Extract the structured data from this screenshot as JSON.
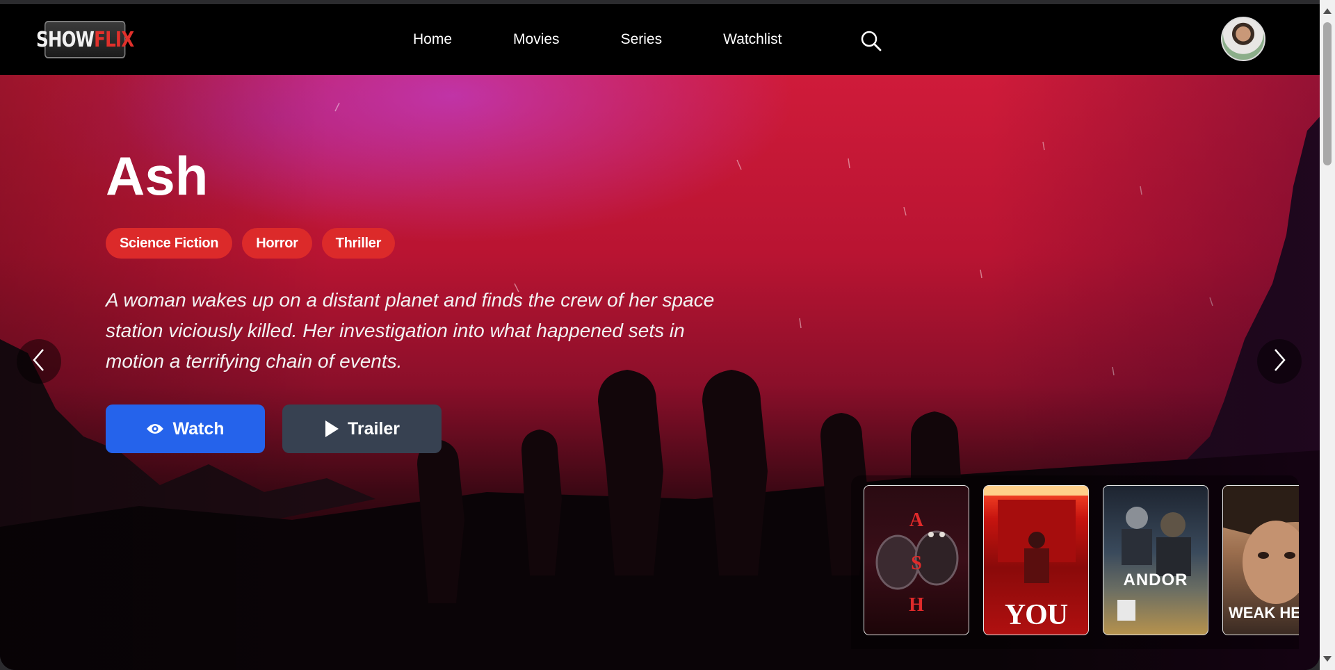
{
  "logo": {
    "show": "SHOW",
    "flix": "FLIX"
  },
  "nav": {
    "links": [
      "Home",
      "Movies",
      "Series",
      "Watchlist"
    ],
    "search_icon": "search-icon",
    "avatar": "user-avatar"
  },
  "hero": {
    "title": "Ash",
    "genres": [
      "Science Fiction",
      "Horror",
      "Thriller"
    ],
    "description": "A woman wakes up on a distant planet and finds the crew of her space station viciously killed. Her investigation into what happened sets in motion a terrifying chain of events.",
    "watch_label": "Watch",
    "trailer_label": "Trailer",
    "watch_icon": "eye-icon",
    "trailer_icon": "play-icon",
    "prev_icon": "chevron-left-icon",
    "next_icon": "chevron-right-icon"
  },
  "thumbnails": [
    {
      "title": "ASH",
      "letters": [
        "A",
        "S",
        "H"
      ]
    },
    {
      "title": "YOU"
    },
    {
      "title": "ANDOR"
    },
    {
      "title": "WEAK HE"
    }
  ],
  "colors": {
    "genre_tag": "#dc2a2a",
    "watch_button": "#2563eb",
    "trailer_button": "#374151",
    "hero_red": "#cf1b3a"
  }
}
